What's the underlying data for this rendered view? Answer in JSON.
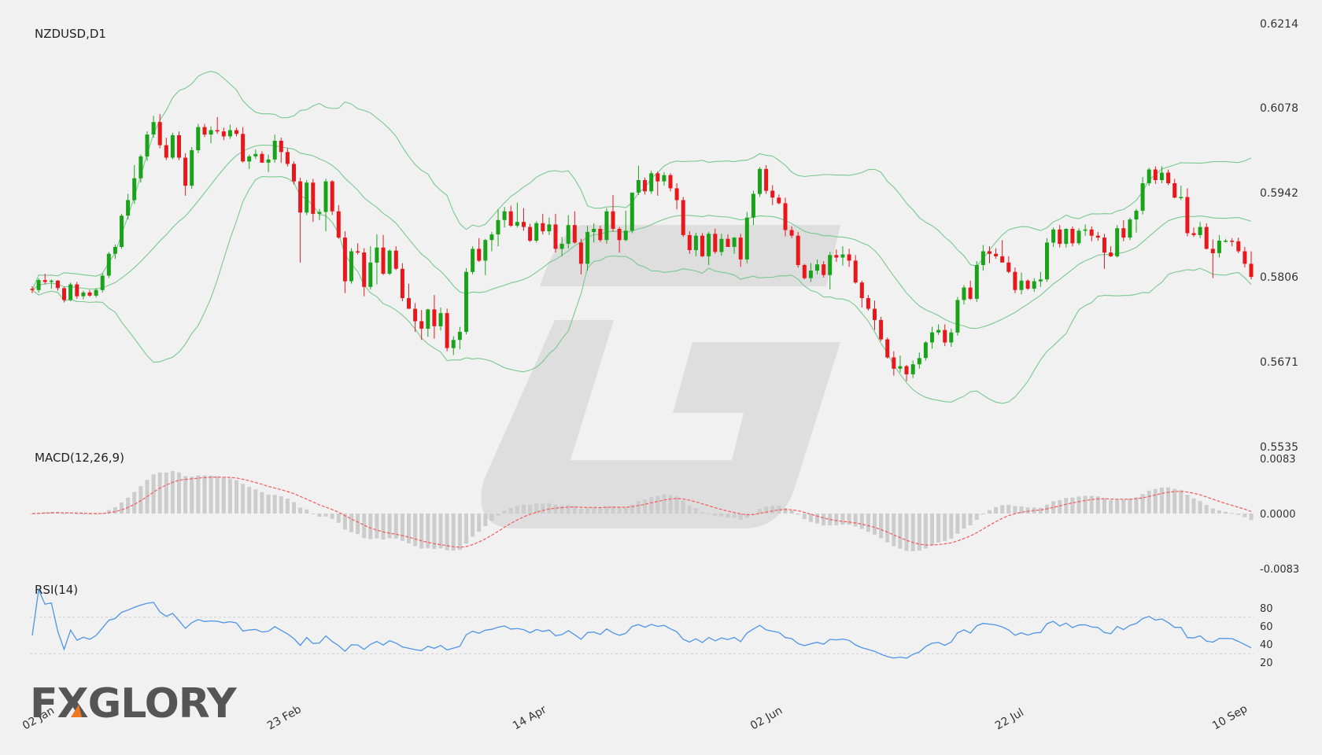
{
  "colors": {
    "up": "#1aa31a",
    "down": "#e8171c",
    "band": "#79c98f",
    "macd_signal": "#f25b5b",
    "macd_hist": "#cccccc",
    "rsi": "#4d94ea",
    "grid": "#cfcfcf",
    "watermark": "#dedede",
    "logo": "#555555",
    "logo_accent": "#f07822"
  },
  "logo": {
    "text": "FXGLORY"
  },
  "chart_data": [
    {
      "type": "candlestick",
      "title": "NZDUSD,D1",
      "y_ticks": [
        "0.6214",
        "0.6078",
        "0.5942",
        "0.5806",
        "0.5671",
        "0.5535"
      ],
      "ylim": [
        0.5535,
        0.6214
      ],
      "x_ticks": [
        {
          "label": "02 Jan",
          "index": 0
        },
        {
          "label": "23 Feb",
          "index": 38
        },
        {
          "label": "14 Apr",
          "index": 77
        },
        {
          "label": "02 Jun",
          "index": 115
        },
        {
          "label": "22 Jul",
          "index": 154
        },
        {
          "label": "10 Sep",
          "index": 193
        }
      ],
      "candles": [
        [
          0.5788,
          0.5792,
          0.5781,
          0.5786
        ],
        [
          0.5786,
          0.5805,
          0.5782,
          0.5802
        ],
        [
          0.5802,
          0.5812,
          0.5795,
          0.5799
        ],
        [
          0.5799,
          0.5803,
          0.5788,
          0.5801
        ],
        [
          0.5801,
          0.5802,
          0.5785,
          0.5789
        ],
        [
          0.5789,
          0.5791,
          0.5766,
          0.577
        ],
        [
          0.577,
          0.5798,
          0.5768,
          0.5795
        ],
        [
          0.5795,
          0.5799,
          0.5772,
          0.5776
        ],
        [
          0.5776,
          0.5785,
          0.5771,
          0.5782
        ],
        [
          0.5782,
          0.5786,
          0.5775,
          0.5777
        ],
        [
          0.5777,
          0.5789,
          0.5774,
          0.5786
        ],
        [
          0.5786,
          0.5813,
          0.5782,
          0.5809
        ],
        [
          0.5809,
          0.5847,
          0.5805,
          0.5844
        ],
        [
          0.5844,
          0.5859,
          0.5836,
          0.5855
        ],
        [
          0.5855,
          0.5908,
          0.5852,
          0.5905
        ],
        [
          0.5905,
          0.594,
          0.5899,
          0.593
        ],
        [
          0.593,
          0.5986,
          0.5924,
          0.5965
        ],
        [
          0.5965,
          0.6003,
          0.5958,
          0.6
        ],
        [
          0.6,
          0.604,
          0.5993,
          0.6035
        ],
        [
          0.6035,
          0.6065,
          0.603,
          0.6055
        ],
        [
          0.6055,
          0.6068,
          0.6013,
          0.6018
        ],
        [
          0.6018,
          0.603,
          0.5994,
          0.5998
        ],
        [
          0.5998,
          0.6038,
          0.5995,
          0.6034
        ],
        [
          0.6034,
          0.604,
          0.5994,
          0.5998
        ],
        [
          0.5998,
          0.6005,
          0.5937,
          0.5953
        ],
        [
          0.5953,
          0.6015,
          0.5948,
          0.601
        ],
        [
          0.601,
          0.6052,
          0.6005,
          0.6047
        ],
        [
          0.6047,
          0.6052,
          0.6031,
          0.6035
        ],
        [
          0.6035,
          0.6048,
          0.6021,
          0.6042
        ],
        [
          0.6042,
          0.6063,
          0.6036,
          0.604
        ],
        [
          0.604,
          0.6046,
          0.6026,
          0.6032
        ],
        [
          0.6032,
          0.6051,
          0.6028,
          0.6042
        ],
        [
          0.6042,
          0.6046,
          0.6032,
          0.6036
        ],
        [
          0.6036,
          0.6047,
          0.599,
          0.5992
        ],
        [
          0.5992,
          0.6003,
          0.598,
          0.6
        ],
        [
          0.6,
          0.6011,
          0.5996,
          0.6004
        ],
        [
          0.6004,
          0.6008,
          0.599,
          0.599
        ],
        [
          0.599,
          0.6003,
          0.5975,
          0.5995
        ],
        [
          0.5995,
          0.6035,
          0.599,
          0.6025
        ],
        [
          0.6025,
          0.603,
          0.599,
          0.6007
        ],
        [
          0.6007,
          0.6013,
          0.5984,
          0.5988
        ],
        [
          0.5988,
          0.5992,
          0.5955,
          0.596
        ],
        [
          0.596,
          0.5966,
          0.583,
          0.591
        ],
        [
          0.591,
          0.5962,
          0.5906,
          0.5958
        ],
        [
          0.5958,
          0.5964,
          0.5895,
          0.5908
        ],
        [
          0.5908,
          0.5916,
          0.5898,
          0.5911
        ],
        [
          0.5911,
          0.5964,
          0.588,
          0.596
        ],
        [
          0.596,
          0.5962,
          0.5906,
          0.5912
        ],
        [
          0.5912,
          0.5922,
          0.5868,
          0.587
        ],
        [
          0.587,
          0.588,
          0.5781,
          0.58
        ],
        [
          0.58,
          0.5853,
          0.5796,
          0.5848
        ],
        [
          0.5848,
          0.5861,
          0.5843,
          0.5846
        ],
        [
          0.5846,
          0.5853,
          0.5776,
          0.5791
        ],
        [
          0.5791,
          0.5856,
          0.5787,
          0.583
        ],
        [
          0.583,
          0.5875,
          0.5795,
          0.5854
        ],
        [
          0.5854,
          0.5874,
          0.581,
          0.5812
        ],
        [
          0.5812,
          0.5851,
          0.581,
          0.5849
        ],
        [
          0.5849,
          0.5856,
          0.5818,
          0.582
        ],
        [
          0.582,
          0.5829,
          0.5768,
          0.5773
        ],
        [
          0.5773,
          0.5796,
          0.5757,
          0.5756
        ],
        [
          0.5756,
          0.5765,
          0.5719,
          0.5736
        ],
        [
          0.5736,
          0.5754,
          0.5706,
          0.5724
        ],
        [
          0.5724,
          0.5756,
          0.5711,
          0.5755
        ],
        [
          0.5755,
          0.5778,
          0.5708,
          0.5728
        ],
        [
          0.5728,
          0.5758,
          0.5721,
          0.5749
        ],
        [
          0.5749,
          0.5756,
          0.5688,
          0.5693
        ],
        [
          0.5693,
          0.5712,
          0.5682,
          0.5706
        ],
        [
          0.5706,
          0.5727,
          0.5691,
          0.5719
        ],
        [
          0.5719,
          0.5821,
          0.5715,
          0.5815
        ],
        [
          0.5815,
          0.5856,
          0.5811,
          0.5852
        ],
        [
          0.5852,
          0.5869,
          0.5831,
          0.5833
        ],
        [
          0.5833,
          0.5868,
          0.581,
          0.5866
        ],
        [
          0.5866,
          0.5879,
          0.5848,
          0.5875
        ],
        [
          0.5875,
          0.5915,
          0.5856,
          0.5898
        ],
        [
          0.5898,
          0.5919,
          0.5886,
          0.5912
        ],
        [
          0.5912,
          0.5921,
          0.5887,
          0.5889
        ],
        [
          0.5889,
          0.5926,
          0.5886,
          0.5895
        ],
        [
          0.5895,
          0.5917,
          0.5881,
          0.5887
        ],
        [
          0.5887,
          0.5892,
          0.5863,
          0.5865
        ],
        [
          0.5865,
          0.5896,
          0.5862,
          0.5893
        ],
        [
          0.5893,
          0.5908,
          0.5875,
          0.588
        ],
        [
          0.588,
          0.5902,
          0.5874,
          0.5891
        ],
        [
          0.5891,
          0.5908,
          0.5846,
          0.5852
        ],
        [
          0.5852,
          0.5871,
          0.584,
          0.586
        ],
        [
          0.586,
          0.5906,
          0.5853,
          0.589
        ],
        [
          0.589,
          0.5912,
          0.586,
          0.5862
        ],
        [
          0.5862,
          0.5868,
          0.5811,
          0.5828
        ],
        [
          0.5828,
          0.5889,
          0.5817,
          0.5879
        ],
        [
          0.5879,
          0.5893,
          0.5862,
          0.5884
        ],
        [
          0.5884,
          0.5889,
          0.5863,
          0.5866
        ],
        [
          0.5866,
          0.5917,
          0.586,
          0.5912
        ],
        [
          0.5912,
          0.5938,
          0.588,
          0.5884
        ],
        [
          0.5884,
          0.5887,
          0.5846,
          0.5866
        ],
        [
          0.5866,
          0.5913,
          0.5864,
          0.5881
        ],
        [
          0.5881,
          0.5942,
          0.5877,
          0.5942
        ],
        [
          0.5942,
          0.5985,
          0.5938,
          0.5962
        ],
        [
          0.5962,
          0.5966,
          0.5939,
          0.5944
        ],
        [
          0.5944,
          0.5977,
          0.594,
          0.5973
        ],
        [
          0.5973,
          0.5976,
          0.5937,
          0.596
        ],
        [
          0.596,
          0.5975,
          0.5953,
          0.597
        ],
        [
          0.597,
          0.5973,
          0.5944,
          0.5949
        ],
        [
          0.5949,
          0.5957,
          0.5915,
          0.593
        ],
        [
          0.593,
          0.5935,
          0.5871,
          0.5874
        ],
        [
          0.5874,
          0.588,
          0.5844,
          0.585
        ],
        [
          0.585,
          0.5878,
          0.584,
          0.5873
        ],
        [
          0.5873,
          0.5877,
          0.5839,
          0.584
        ],
        [
          0.584,
          0.5879,
          0.5826,
          0.5876
        ],
        [
          0.5876,
          0.5884,
          0.5844,
          0.5847
        ],
        [
          0.5847,
          0.5876,
          0.5841,
          0.5868
        ],
        [
          0.5868,
          0.5875,
          0.5855,
          0.5855
        ],
        [
          0.5855,
          0.5871,
          0.5844,
          0.587
        ],
        [
          0.587,
          0.5876,
          0.5823,
          0.5835
        ],
        [
          0.5835,
          0.5911,
          0.5829,
          0.5902
        ],
        [
          0.5902,
          0.5945,
          0.589,
          0.594
        ],
        [
          0.594,
          0.5983,
          0.5935,
          0.598
        ],
        [
          0.598,
          0.5986,
          0.594,
          0.5945
        ],
        [
          0.5945,
          0.5954,
          0.5922,
          0.5934
        ],
        [
          0.5934,
          0.5939,
          0.5923,
          0.5925
        ],
        [
          0.5925,
          0.5934,
          0.5872,
          0.5882
        ],
        [
          0.5882,
          0.5888,
          0.5869,
          0.5873
        ],
        [
          0.5873,
          0.5879,
          0.5822,
          0.5826
        ],
        [
          0.5826,
          0.5828,
          0.5803,
          0.5805
        ],
        [
          0.5805,
          0.5829,
          0.5799,
          0.5817
        ],
        [
          0.5817,
          0.5835,
          0.5811,
          0.5827
        ],
        [
          0.5827,
          0.5832,
          0.5806,
          0.581
        ],
        [
          0.581,
          0.5847,
          0.5787,
          0.5842
        ],
        [
          0.5842,
          0.5851,
          0.5831,
          0.5838
        ],
        [
          0.5838,
          0.5856,
          0.5825,
          0.5843
        ],
        [
          0.5843,
          0.5852,
          0.5823,
          0.5833
        ],
        [
          0.5833,
          0.5842,
          0.5796,
          0.5798
        ],
        [
          0.5798,
          0.5801,
          0.5758,
          0.5773
        ],
        [
          0.5773,
          0.5778,
          0.5753,
          0.5756
        ],
        [
          0.5756,
          0.5769,
          0.5722,
          0.5738
        ],
        [
          0.5738,
          0.5743,
          0.5704,
          0.5707
        ],
        [
          0.5707,
          0.571,
          0.5676,
          0.5678
        ],
        [
          0.5678,
          0.5688,
          0.5649,
          0.566
        ],
        [
          0.566,
          0.5681,
          0.5654,
          0.5664
        ],
        [
          0.5664,
          0.5666,
          0.564,
          0.5651
        ],
        [
          0.5651,
          0.5673,
          0.5645,
          0.5667
        ],
        [
          0.5667,
          0.5686,
          0.566,
          0.5677
        ],
        [
          0.5677,
          0.5704,
          0.5673,
          0.5702
        ],
        [
          0.5702,
          0.5727,
          0.5692,
          0.5718
        ],
        [
          0.5718,
          0.5731,
          0.5714,
          0.5722
        ],
        [
          0.5722,
          0.5731,
          0.5696,
          0.5702
        ],
        [
          0.5702,
          0.5724,
          0.5695,
          0.5718
        ],
        [
          0.5718,
          0.5775,
          0.5713,
          0.577
        ],
        [
          0.577,
          0.5794,
          0.5763,
          0.579
        ],
        [
          0.579,
          0.5801,
          0.577,
          0.5772
        ],
        [
          0.5772,
          0.5832,
          0.5767,
          0.5826
        ],
        [
          0.5826,
          0.5858,
          0.5817,
          0.5848
        ],
        [
          0.5848,
          0.5856,
          0.5829,
          0.5844
        ],
        [
          0.5844,
          0.5853,
          0.5836,
          0.584
        ],
        [
          0.584,
          0.5866,
          0.5835,
          0.583
        ],
        [
          0.583,
          0.584,
          0.5813,
          0.5815
        ],
        [
          0.5815,
          0.5822,
          0.5781,
          0.5786
        ],
        [
          0.5786,
          0.5814,
          0.5779,
          0.5801
        ],
        [
          0.5801,
          0.5803,
          0.5786,
          0.5788
        ],
        [
          0.5788,
          0.5805,
          0.5783,
          0.58
        ],
        [
          0.58,
          0.5815,
          0.5791,
          0.5803
        ],
        [
          0.5803,
          0.5869,
          0.5799,
          0.5862
        ],
        [
          0.5862,
          0.5886,
          0.5855,
          0.5883
        ],
        [
          0.5883,
          0.589,
          0.5854,
          0.586
        ],
        [
          0.586,
          0.5885,
          0.5854,
          0.5884
        ],
        [
          0.5884,
          0.5888,
          0.5856,
          0.5861
        ],
        [
          0.5861,
          0.5885,
          0.5858,
          0.5881
        ],
        [
          0.5881,
          0.5891,
          0.5873,
          0.5883
        ],
        [
          0.5883,
          0.5888,
          0.5864,
          0.5873
        ],
        [
          0.5873,
          0.5879,
          0.5865,
          0.587
        ],
        [
          0.587,
          0.5876,
          0.582,
          0.5846
        ],
        [
          0.5846,
          0.5856,
          0.5839,
          0.584
        ],
        [
          0.584,
          0.589,
          0.5838,
          0.5885
        ],
        [
          0.5885,
          0.5898,
          0.5864,
          0.587
        ],
        [
          0.587,
          0.5902,
          0.5866,
          0.5899
        ],
        [
          0.5899,
          0.5916,
          0.5878,
          0.5913
        ],
        [
          0.5913,
          0.5967,
          0.5907,
          0.5957
        ],
        [
          0.5957,
          0.5982,
          0.5953,
          0.5979
        ],
        [
          0.5979,
          0.5984,
          0.5956,
          0.5962
        ],
        [
          0.5962,
          0.5984,
          0.5957,
          0.5974
        ],
        [
          0.5974,
          0.5979,
          0.5954,
          0.5957
        ],
        [
          0.5957,
          0.5964,
          0.5933,
          0.5934
        ],
        [
          0.5934,
          0.5953,
          0.593,
          0.5935
        ],
        [
          0.5935,
          0.5949,
          0.5872,
          0.5877
        ],
        [
          0.5877,
          0.5886,
          0.5871,
          0.5874
        ],
        [
          0.5874,
          0.5895,
          0.5869,
          0.5887
        ],
        [
          0.5887,
          0.5893,
          0.5851,
          0.5852
        ],
        [
          0.5852,
          0.5867,
          0.5805,
          0.5845
        ],
        [
          0.5845,
          0.5874,
          0.5838,
          0.5865
        ],
        [
          0.5865,
          0.5868,
          0.5862,
          0.5865
        ],
        [
          0.5865,
          0.5869,
          0.5856,
          0.5864
        ],
        [
          0.5864,
          0.587,
          0.5845,
          0.5848
        ],
        [
          0.5848,
          0.5855,
          0.5822,
          0.5828
        ],
        [
          0.5828,
          0.5848,
          0.5803,
          0.5807
        ]
      ],
      "bollinger": {
        "period": 20,
        "k": 2
      }
    },
    {
      "type": "histogram+line",
      "title": "MACD(12,26,9)",
      "y_ticks": [
        "0.0083",
        "0.0000",
        "-0.0083"
      ],
      "ylim": [
        -0.0083,
        0.0083
      ]
    },
    {
      "type": "line",
      "title": "RSI(14)",
      "y_ticks": [
        "80",
        "60",
        "40",
        "20"
      ],
      "ylim": [
        0,
        100
      ],
      "levels": [
        70,
        30
      ]
    }
  ]
}
